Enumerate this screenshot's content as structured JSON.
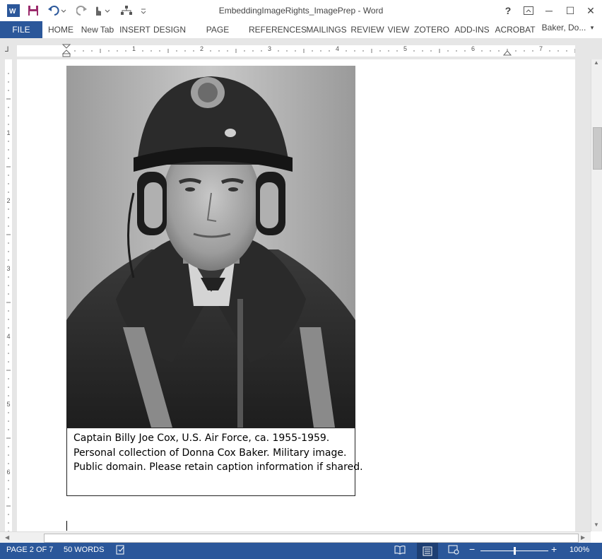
{
  "window": {
    "title": "EmbeddingImageRights_ImagePrep - Word",
    "help": "?",
    "minimize": "─",
    "maximize": "☐",
    "close": "✕",
    "user": "Baker, Do..."
  },
  "ribbon": {
    "tabs": [
      "FILE",
      "HOME",
      "New Tab",
      "INSERT",
      "DESIGN",
      "PAGE LAYOUT",
      "REFERENCES",
      "MAILINGS",
      "REVIEW",
      "VIEW",
      "ZOTERO",
      "ADD-INS",
      "ACROBAT"
    ]
  },
  "ruler": {
    "numbers": [
      "1",
      "2",
      "3",
      "4",
      "5",
      "6",
      "7"
    ],
    "vnumbers": [
      "1",
      "2",
      "3",
      "4",
      "5",
      "6"
    ]
  },
  "document": {
    "caption_lines": [
      "Captain Billy Joe Cox, U.S. Air Force, ca. 1955-1959.",
      "Personal collection of Donna Cox Baker. Military image.",
      "Public domain. Please retain caption information if shared."
    ]
  },
  "status": {
    "page": "PAGE 2 OF 7",
    "words": "50 WORDS",
    "zoom": "100%",
    "zoom_level": 1.0
  },
  "colors": {
    "accent": "#2b579a"
  }
}
